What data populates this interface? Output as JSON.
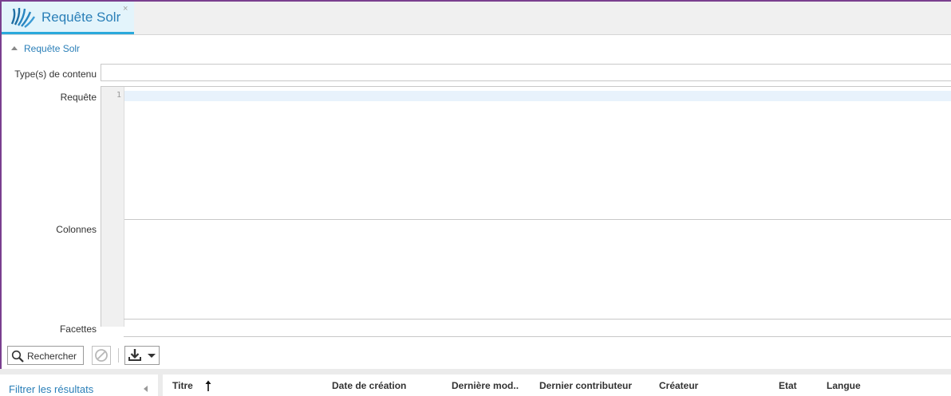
{
  "tab": {
    "title": "Requête Solr",
    "close": "×",
    "logo_icon": "ametys-logo-icon"
  },
  "section": {
    "title": "Requête Solr",
    "collapse_icon": "triangle-up-icon"
  },
  "form": {
    "content_types_label": "Type(s) de contenu",
    "content_types_value": "",
    "query_label": "Requête",
    "query_first_line_number": "1",
    "columns_label": "Colonnes",
    "facets_label": "Facettes"
  },
  "toolbar": {
    "search_label": "Rechercher",
    "search_icon": "magnifier-icon",
    "stop_icon": "stop-icon",
    "export_icon": "download-icon"
  },
  "results": {
    "filter_link": "Filtrer les résultats",
    "columns": [
      {
        "label": "Titre",
        "sorted": "asc"
      },
      {
        "label": "Date de création"
      },
      {
        "label": "Dernière mod.."
      },
      {
        "label": "Dernier contributeur"
      },
      {
        "label": "Créateur"
      },
      {
        "label": "Etat"
      },
      {
        "label": "Langue"
      }
    ]
  },
  "colors": {
    "accent": "#2a7fb8",
    "tab_active_bg": "#e3f4fb",
    "tab_underline": "#2aa9dc",
    "frame": "#7a3f8f"
  }
}
